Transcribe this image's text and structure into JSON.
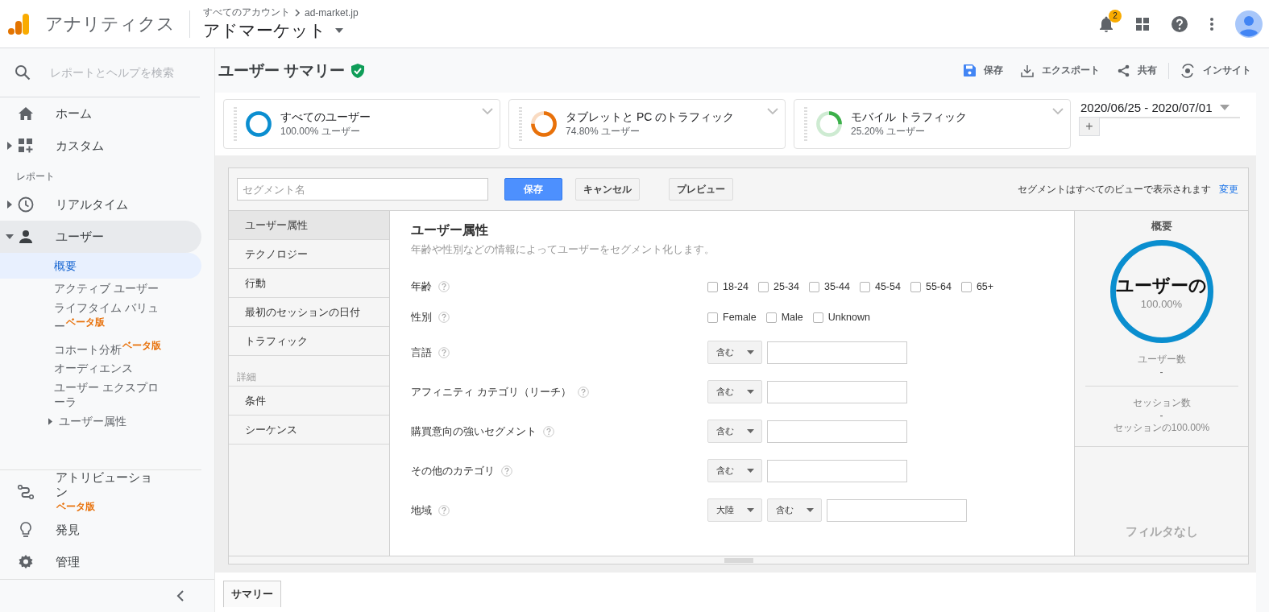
{
  "header": {
    "product": "アナリティクス",
    "breadcrumb": "すべてのアカウント",
    "account": "ad-market.jp",
    "property": "アドマーケット",
    "notification_count": "2"
  },
  "sidebar": {
    "search_placeholder": "レポートとヘルプを検索",
    "top_items": [
      {
        "label": "ホーム"
      },
      {
        "label": "カスタム",
        "expanded": false
      }
    ],
    "section": "レポート",
    "report_items": [
      {
        "label": "リアルタイム",
        "expanded": false,
        "selected": false
      },
      {
        "label": "ユーザー",
        "expanded": true,
        "selected": true,
        "children": [
          {
            "label": "概要",
            "selected": true
          },
          {
            "label": "アクティブ ユーザー",
            "selected": false
          },
          {
            "label": "ライフタイム バリュー",
            "badge": "ベータ版",
            "selected": false
          },
          {
            "label": "コホート分析",
            "badge": "ベータ版",
            "selected": false
          },
          {
            "label": "オーディエンス",
            "selected": false
          },
          {
            "label": "ユーザー エクスプローラ",
            "selected": false
          },
          {
            "label": "ユーザー属性",
            "expanded": false,
            "selected": false
          }
        ]
      }
    ],
    "bottom_items": [
      {
        "label": "アトリビューション",
        "badge": "ベータ版"
      },
      {
        "label": "発見"
      },
      {
        "label": "管理"
      }
    ]
  },
  "page": {
    "title": "ユーザー サマリー",
    "actions": [
      {
        "label": "保存"
      },
      {
        "label": "エクスポート"
      },
      {
        "label": "共有"
      },
      {
        "label": "インサイト"
      }
    ],
    "segments": [
      {
        "name": "すべてのユーザー",
        "share": "100.00% ユーザー",
        "level": 1,
        "color": "#0b8ed0"
      },
      {
        "name": "タブレットと PC のトラフィック",
        "share": "74.80% ユーザー",
        "level": 0.748,
        "color": "#e8710a"
      },
      {
        "name": "モバイル トラフィック",
        "share": "25.20% ユーザー",
        "level": 0.252,
        "color": "#3cb04a"
      }
    ],
    "date_range": "2020/06/25 - 2020/07/01",
    "add_label": "+"
  },
  "segment_editor": {
    "name_placeholder": "セグメント名",
    "buttons": [
      {
        "label": "保存",
        "kind": "primary"
      },
      {
        "label": "キャンセル",
        "kind": "default"
      },
      {
        "label": "プレビュー",
        "kind": "spaced"
      }
    ],
    "notice": "セグメントはすべてのビューで表示されます",
    "notice_link": "変更",
    "categories": [
      {
        "label": "ユーザー属性",
        "selected": true
      },
      {
        "label": "テクノロジー",
        "selected": false
      },
      {
        "label": "行動",
        "selected": false
      },
      {
        "label": "最初のセッションの日付",
        "selected": false
      },
      {
        "label": "トラフィック",
        "selected": false
      }
    ],
    "advanced_heading": "詳細",
    "advanced": [
      {
        "label": "条件",
        "selected": false
      },
      {
        "label": "シーケンス",
        "selected": false
      }
    ],
    "panel_title": "ユーザー属性",
    "panel_description": "年齢や性別などの情報によってユーザーをセグメント化します。",
    "rows": [
      {
        "label": "年齢",
        "kind": "checkboxes",
        "options": [
          {
            "label": "18-24",
            "checked": false
          },
          {
            "label": "25-34",
            "checked": false
          },
          {
            "label": "35-44",
            "checked": false
          },
          {
            "label": "45-54",
            "checked": false
          },
          {
            "label": "55-64",
            "checked": false
          },
          {
            "label": "65+",
            "checked": false
          }
        ]
      },
      {
        "label": "性別",
        "kind": "checkboxes",
        "options": [
          {
            "label": "Female",
            "checked": false
          },
          {
            "label": "Male",
            "checked": false
          },
          {
            "label": "Unknown",
            "checked": false
          }
        ]
      },
      {
        "label": "言語",
        "kind": "filter",
        "selects": [
          "含む"
        ]
      },
      {
        "label": "アフィニティ カテゴリ（リーチ）",
        "kind": "filter",
        "selects": [
          "含む"
        ]
      },
      {
        "label": "購買意向の強いセグメント",
        "kind": "filter",
        "selects": [
          "含む"
        ]
      },
      {
        "label": "その他のカテゴリ",
        "kind": "filter",
        "selects": [
          "含む"
        ]
      },
      {
        "label": "地域",
        "kind": "filter",
        "selects": [
          "大陸",
          "含む"
        ]
      }
    ],
    "summary": {
      "heading": "概要",
      "circle_label": "ユーザーの",
      "circle_value": "100.00%",
      "users_label": "ユーザー数",
      "users_value": "-",
      "sessions_label": "セッション数",
      "sessions_value": "-",
      "sessions_share": "セッションの100.00%",
      "filter_note": "フィルタなし"
    }
  },
  "bottom_tabs": [
    {
      "label": "サマリー",
      "selected": true
    }
  ]
}
